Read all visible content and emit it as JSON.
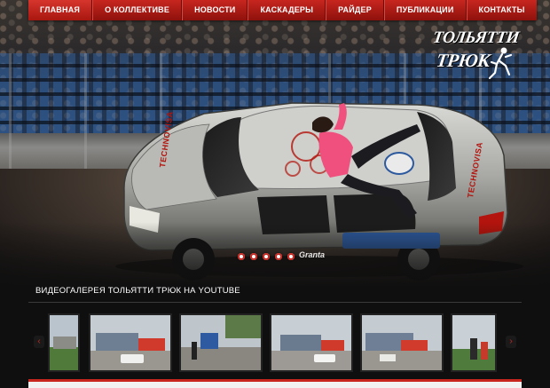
{
  "nav": {
    "items": [
      {
        "label": "ГЛАВНАЯ",
        "active": true
      },
      {
        "label": "О КОЛЛЕКТИВЕ",
        "active": false
      },
      {
        "label": "НОВОСТИ",
        "active": false
      },
      {
        "label": "КАСКАДЕРЫ",
        "active": false
      },
      {
        "label": "РАЙДЕР",
        "active": false
      },
      {
        "label": "ПУБЛИКАЦИИ",
        "active": false
      },
      {
        "label": "КОНТАКТЫ",
        "active": false
      }
    ]
  },
  "logo": {
    "line1": "ТОЛЬЯТТИ",
    "line2": "ТРЮК"
  },
  "hero": {
    "car_brand_side": "TECHNOVISA",
    "car_brand_rear": "TECHNOVISA",
    "car_model": "Granta",
    "slides_count": 5,
    "active_slide": 1
  },
  "gallery": {
    "title": "ВИДЕОГАЛЕРЕЯ ТОЛЬЯТТИ ТРЮК НА YOUTUBE",
    "prev_label": "‹",
    "next_label": "›"
  },
  "colors": {
    "accent": "#c7261f",
    "nav_dark": "#8e110c",
    "background": "#0f0f0f"
  }
}
